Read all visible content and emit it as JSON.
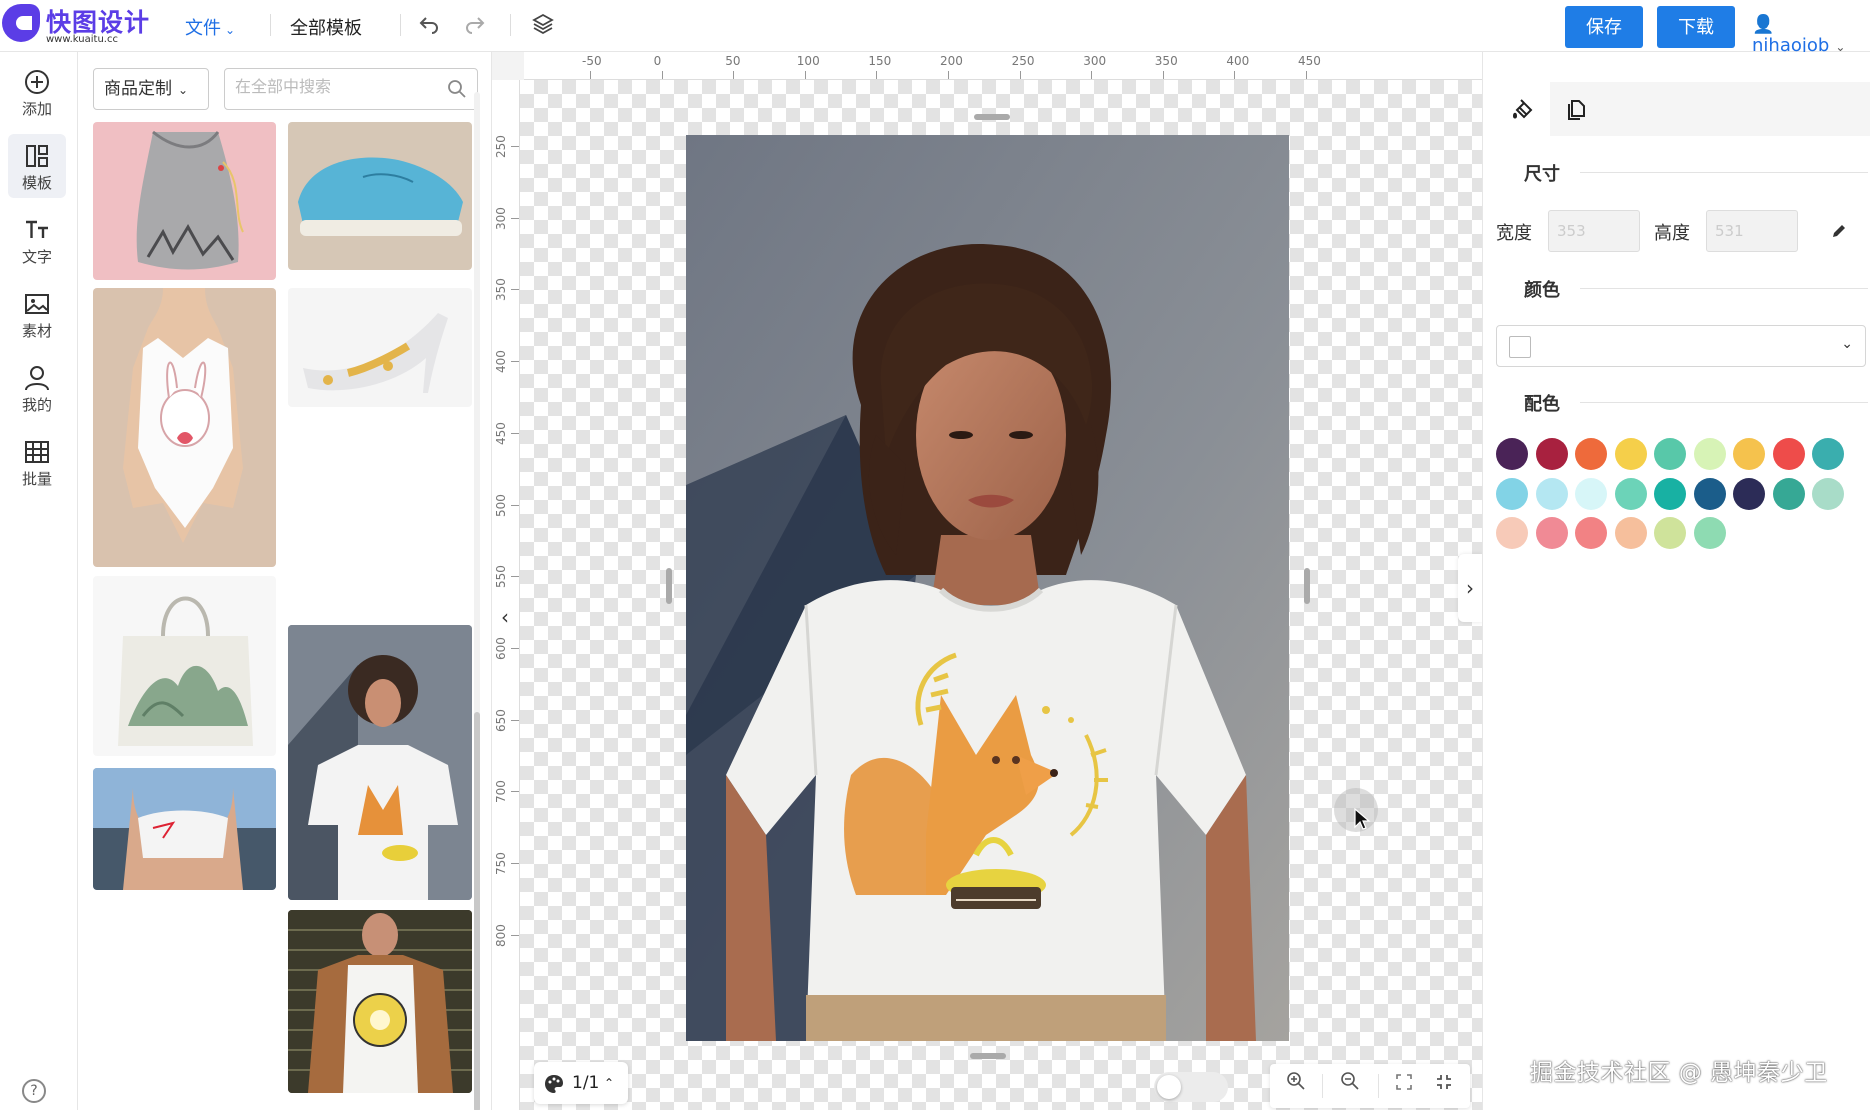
{
  "app": {
    "logo_title": "快图设计",
    "logo_url": "www.kuaitu.cc"
  },
  "topbar": {
    "file_menu": "文件",
    "templates_menu": "全部模板",
    "undo_icon": "undo-icon",
    "redo_icon": "redo-icon",
    "layers_icon": "layers-icon",
    "save_label": "保存",
    "download_label": "下载",
    "username": "nihaojob"
  },
  "sidebar": {
    "items": [
      {
        "label": "添加",
        "icon": "plus-circle-icon"
      },
      {
        "label": "模板",
        "icon": "layout-icon"
      },
      {
        "label": "文字",
        "icon": "text-icon"
      },
      {
        "label": "素材",
        "icon": "image-icon"
      },
      {
        "label": "我的",
        "icon": "user-icon"
      },
      {
        "label": "批量",
        "icon": "table-icon"
      }
    ],
    "active": "模板",
    "help_icon": "help-icon"
  },
  "template_panel": {
    "category": "商品定制",
    "search_placeholder": "在全部中搜索",
    "thumbnails": [
      {
        "subject": "drawstring-bag"
      },
      {
        "subject": "sneaker"
      },
      {
        "subject": "bodysuit"
      },
      {
        "subject": "high-heel"
      },
      {
        "subject": "tote-bag"
      },
      {
        "subject": "tshirt-woman-fox"
      },
      {
        "subject": "sports-top"
      },
      {
        "subject": "tshirt-man-jacket"
      }
    ]
  },
  "canvas": {
    "ruler_top": [
      "-50",
      "0",
      "50",
      "100",
      "150",
      "200",
      "250",
      "300",
      "350",
      "400",
      "450"
    ],
    "ruler_left": [
      "250",
      "300",
      "350",
      "400",
      "450",
      "500",
      "550",
      "600",
      "650",
      "700",
      "750",
      "800"
    ],
    "page_indicator": "1/1",
    "zoom_in_icon": "zoom-in-icon",
    "zoom_out_icon": "zoom-out-icon",
    "fit_icon": "fit-screen-icon",
    "shrink_icon": "shrink-icon"
  },
  "right_panel": {
    "tabs": [
      "background-icon",
      "copy-page-icon"
    ],
    "size_title": "尺寸",
    "width_label": "宽度",
    "width_value": "353",
    "height_label": "高度",
    "height_value": "531",
    "color_title": "颜色",
    "color_value": "#ffffff",
    "palette_title": "配色",
    "palette": [
      "#4a2357",
      "#a8213f",
      "#ee6a3b",
      "#f5cf4a",
      "#58c8a9",
      "#d7f3b6",
      "#f5c24d",
      "#ee4c4a",
      "#3aaeae",
      "#82d3e6",
      "#b4e7f2",
      "#d7f6f8",
      "#6cd3b8",
      "#18b1a3",
      "#1b5d8a",
      "#2c2c57",
      "#36a895",
      "#a8dcc8",
      "#f7cab8",
      "#f08a95",
      "#f28284",
      "#f6bf9c",
      "#cfe39b",
      "#8edbb2"
    ]
  },
  "watermark": "掘金技术社区 @ 愚坤秦少卫"
}
